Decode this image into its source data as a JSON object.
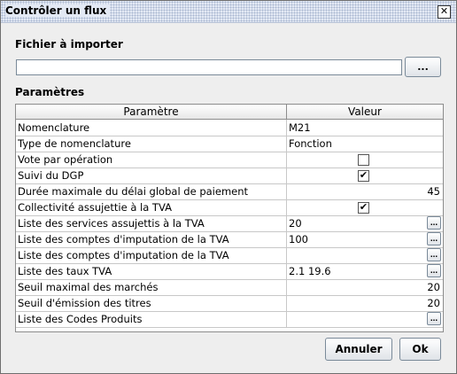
{
  "window": {
    "title": "Contrôler un flux",
    "close_glyph": "✕"
  },
  "file_section": {
    "label": "Fichier à importer",
    "value": "",
    "browse_label": "..."
  },
  "params_section": {
    "label": "Paramètres"
  },
  "table": {
    "columns": [
      "Paramètre",
      "Valeur"
    ],
    "rows": [
      {
        "param": "Nomenclature",
        "value": "M21"
      },
      {
        "param": "Type de nomenclature",
        "value": "Fonction"
      },
      {
        "param": "Vote par opération",
        "checkbox": ""
      },
      {
        "param": "Suivi du DGP",
        "checkbox": "✔"
      },
      {
        "param": "Durée maximale du délai global de paiement",
        "value": "45"
      },
      {
        "param": "Collectivité assujettie à la TVA",
        "checkbox": "✔"
      },
      {
        "param": "Liste des services assujettis à la TVA",
        "value": "20",
        "button": "..."
      },
      {
        "param": "Liste des comptes d'imputation de la TVA",
        "value": "100",
        "button": "..."
      },
      {
        "param": "Liste des comptes d'imputation de la TVA",
        "value": "",
        "button": "..."
      },
      {
        "param": "Liste des taux TVA",
        "value": "2.1 19.6",
        "button": "..."
      },
      {
        "param": "Seuil maximal des marchés",
        "value": "20"
      },
      {
        "param": "Seuil d'émission des titres",
        "value": "20"
      },
      {
        "param": "Liste des Codes Produits",
        "value": "",
        "button": "..."
      }
    ]
  },
  "actions": {
    "cancel_label": "Annuler",
    "ok_label": "Ok"
  }
}
